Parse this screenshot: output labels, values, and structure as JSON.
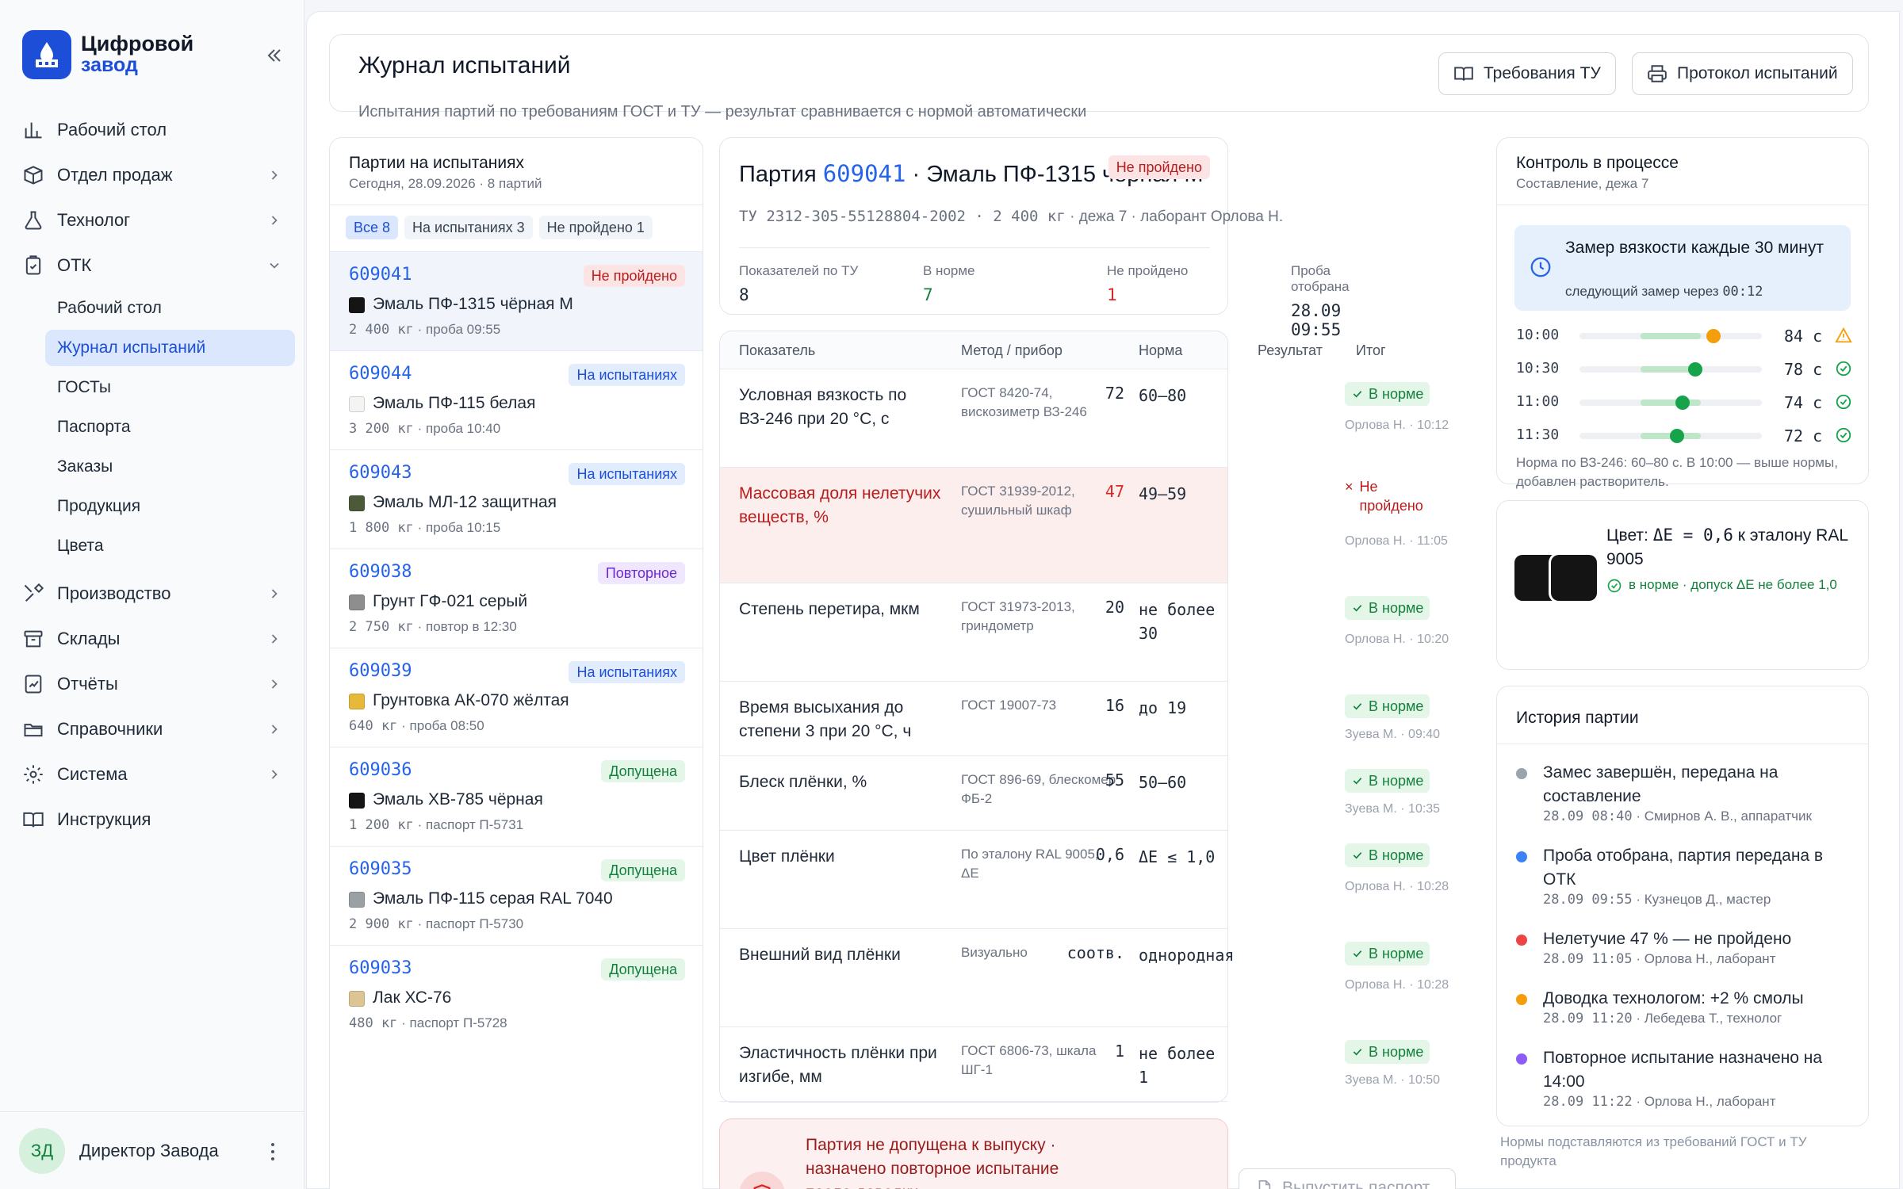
{
  "app": {
    "name_line1": "Цифровой",
    "name_line2": "завод",
    "brand_color": "#1d4ed8"
  },
  "nav": [
    {
      "label": "Рабочий стол",
      "icon": "chart-bars-icon",
      "has_chevron": false
    },
    {
      "label": "Отдел продаж",
      "icon": "box-icon",
      "has_chevron": true
    },
    {
      "label": "Технолог",
      "icon": "flask-icon",
      "has_chevron": true
    },
    {
      "label": "ОТК",
      "icon": "clipboard-check-icon",
      "has_chevron": true,
      "expanded": true
    },
    {
      "label": "Производство",
      "icon": "tools-icon",
      "has_chevron": true
    },
    {
      "label": "Склады",
      "icon": "archive-icon",
      "has_chevron": true
    },
    {
      "label": "Отчёты",
      "icon": "report-icon",
      "has_chevron": true
    },
    {
      "label": "Справочники",
      "icon": "folder-icon",
      "has_chevron": true
    },
    {
      "label": "Система",
      "icon": "gear-icon",
      "has_chevron": true
    },
    {
      "label": "Инструкция",
      "icon": "book-icon",
      "has_chevron": false
    }
  ],
  "subnav": [
    "Рабочий стол",
    "Журнал испытаний",
    "ГОСТы",
    "Паспорта",
    "Заказы",
    "Продукция",
    "Цвета"
  ],
  "subnav_active": "Журнал испытаний",
  "user": {
    "initials": "ЗД",
    "name": "Директор Завода"
  },
  "header": {
    "title": "Журнал испытаний",
    "subtitle": "Испытания партий по требованиям ГОСТ и ТУ — результат сравнивается с нормой автоматически",
    "btn_requirements": "Требования ТУ",
    "btn_protocol": "Протокол испытаний"
  },
  "batches_panel": {
    "title": "Партии на испытаниях",
    "subtitle": "Сегодня, 28.09.2026 · 8 партий",
    "filters": [
      "Все 8",
      "На испытаниях 3",
      "Не пройдено 1"
    ],
    "items": [
      {
        "num": "609041",
        "status": "Не пройдено",
        "kind": "fail",
        "name": "Эмаль ПФ-1315 чёрная М",
        "meta_mono": "2 400 кг",
        "meta": " · проба 09:55",
        "swatch": "#151515"
      },
      {
        "num": "609044",
        "status": "На испытаниях",
        "kind": "test",
        "name": "Эмаль ПФ-115 белая",
        "meta_mono": "3 200 кг",
        "meta": " · проба 10:40",
        "swatch": "#f4f4f2"
      },
      {
        "num": "609043",
        "status": "На испытаниях",
        "kind": "test",
        "name": "Эмаль МЛ-12 защитная",
        "meta_mono": "1 800 кг",
        "meta": " · проба 10:15",
        "swatch": "#4d5a3a"
      },
      {
        "num": "609038",
        "status": "Повторное",
        "kind": "repeat",
        "name": "Грунт ГФ-021 серый",
        "meta_mono": "2 750 кг",
        "meta": " · повтор в 12:30",
        "swatch": "#8e8e8e"
      },
      {
        "num": "609039",
        "status": "На испытаниях",
        "kind": "test",
        "name": "Грунтовка АК-070 жёлтая",
        "meta_mono": "640 кг",
        "meta": " · проба 08:50",
        "swatch": "#e7b93a"
      },
      {
        "num": "609036",
        "status": "Допущена",
        "kind": "ok",
        "name": "Эмаль ХВ-785 чёрная",
        "meta_mono": "1 200 кг",
        "meta": " · паспорт П-5731",
        "swatch": "#151515"
      },
      {
        "num": "609035",
        "status": "Допущена",
        "kind": "ok",
        "name": "Эмаль ПФ-115 серая RAL 7040",
        "meta_mono": "2 900 кг",
        "meta": " · паспорт П-5730",
        "swatch": "#9ba0a4"
      },
      {
        "num": "609033",
        "status": "Допущена",
        "kind": "ok",
        "name": "Лак ХС-76",
        "meta_mono": "480 кг",
        "meta": " · паспорт П-5728",
        "swatch": "#dcc592"
      }
    ]
  },
  "detail": {
    "title_prefix": "Партия ",
    "num": "609041",
    "title_suffix": " · Эмаль ПФ-1315 чёрная М",
    "status": "Не пройдено",
    "sub_mono": "ТУ 2312-305-55128804-2002 · 2 400 кг",
    "sub_text": " · дежа 7 · лаборант Орлова Н.",
    "kpis": [
      {
        "label": "Показателей по ТУ",
        "value": "8",
        "color": "#1f2937"
      },
      {
        "label": "В норме",
        "value": "7",
        "color": "#15803d"
      },
      {
        "label": "Не пройдено",
        "value": "1",
        "color": "#dc2626"
      },
      {
        "label": "Проба отобрана",
        "value": "28.09 09:55",
        "color": "#1f2937"
      }
    ]
  },
  "table": {
    "headers": [
      "Показатель",
      "Метод / прибор",
      "Норма",
      "Результат",
      "Итог"
    ],
    "rows": [
      {
        "param": "Условная вязкость по ВЗ-246 при 20 °С, с",
        "method": "ГОСТ 8420-74, вискозиметр ВЗ-246",
        "norm": "60–80",
        "result": "72",
        "ok": true,
        "verdict": "В норме",
        "who": "Орлова Н. · 10:12"
      },
      {
        "param": "Массовая доля нелетучих веществ, %",
        "method": "ГОСТ 31939-2012, сушильный шкаф",
        "norm": "49–59",
        "result": "47",
        "ok": false,
        "verdict": "Не пройдено",
        "who": "Орлова Н. · 11:05"
      },
      {
        "param": "Степень перетира, мкм",
        "method": "ГОСТ 31973-2013, гриндометр",
        "norm": "не более 30",
        "result": "20",
        "ok": true,
        "verdict": "В норме",
        "who": "Орлова Н. · 10:20"
      },
      {
        "param": "Время высыхания до степени 3 при 20 °С, ч",
        "method": "ГОСТ 19007-73",
        "norm": "до 19",
        "result": "16",
        "ok": true,
        "verdict": "В норме",
        "who": "Зуева М. · 09:40"
      },
      {
        "param": "Блеск плёнки, %",
        "method": "ГОСТ 896-69, блескомер ФБ-2",
        "norm": "50–60",
        "result": "55",
        "ok": true,
        "verdict": "В норме",
        "who": "Зуева М. · 10:35"
      },
      {
        "param": "Цвет плёнки",
        "method": "По эталону RAL 9005, ΔE",
        "norm": "ΔE ≤ 1,0",
        "result": "0,6",
        "ok": true,
        "verdict": "В норме",
        "who": "Орлова Н. · 10:28"
      },
      {
        "param": "Внешний вид плёнки",
        "method": "Визуально",
        "norm": "однородная",
        "result": "соотв.",
        "ok": true,
        "verdict": "В норме",
        "who": "Орлова Н. · 10:28"
      },
      {
        "param": "Эластичность плёнки при изгибе, мм",
        "method": "ГОСТ 6806-73, шкала ШГ-1",
        "norm": "не более 1",
        "result": "1",
        "ok": true,
        "verdict": "В норме",
        "who": "Зуева М. · 10:50"
      }
    ]
  },
  "alert": {
    "text": "Партия не допущена к выпуску · назначено повторное испытание после доводки",
    "button": "Выпустить паспорт"
  },
  "process": {
    "title": "Контроль в процессе",
    "subtitle": "Составление, дежа 7",
    "reminder_title": "Замер вязкости каждые 30 минут",
    "reminder_sub": "следующий замер через ",
    "reminder_time": "00:12",
    "axis_range": [
      40,
      100
    ],
    "norm_range": [
      60,
      80
    ],
    "measures": [
      {
        "time": "10:00",
        "value": 84,
        "unit": "с",
        "state": "warn"
      },
      {
        "time": "10:30",
        "value": 78,
        "unit": "с",
        "state": "ok"
      },
      {
        "time": "11:00",
        "value": 74,
        "unit": "с",
        "state": "ok"
      },
      {
        "time": "11:30",
        "value": 72,
        "unit": "с",
        "state": "ok"
      }
    ],
    "note": "Норма по ВЗ-246: 60–80 с. В 10:00 — выше нормы, добавлен растворитель."
  },
  "color_check": {
    "title_text": "Цвет: ",
    "title_mono": "ΔE = 0,6",
    "title_rest": " к эталону RAL 9005",
    "ok_text": "в норме · допуск ΔE не более 1,0"
  },
  "history": {
    "title": "История партии",
    "events": [
      {
        "text": "Замес завершён, передана на составление",
        "time": "28.09 08:40",
        "who": " · Смирнов А. В., аппаратчик",
        "color": "#9ca3af"
      },
      {
        "text": "Проба отобрана, партия передана в ОТК",
        "time": "28.09 09:55",
        "who": " · Кузнецов Д., мастер",
        "color": "#3b82f6"
      },
      {
        "text": "Нелетучие 47 % — не пройдено",
        "time": "28.09 11:05",
        "who": " · Орлова Н., лаборант",
        "color": "#ef4444"
      },
      {
        "text": "Доводка технологом: +2 % смолы",
        "time": "28.09 11:20",
        "who": " · Лебедева Т., технолог",
        "color": "#f59e0b"
      },
      {
        "text": "Повторное испытание назначено на 14:00",
        "time": "28.09 11:22",
        "who": " · Орлова Н., лаборант",
        "color": "#8b5cf6"
      }
    ]
  },
  "footnote": "Нормы подставляются из требований ГОСТ и ТУ продукта"
}
